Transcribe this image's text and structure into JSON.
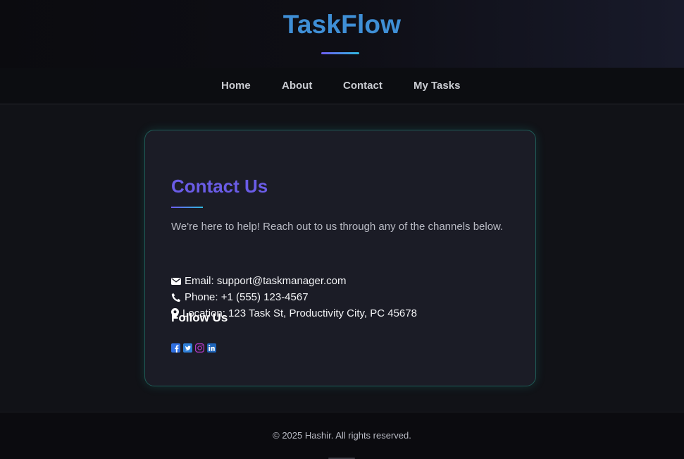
{
  "header": {
    "brand": "TaskFlow",
    "brand_color": "#3f8fd6"
  },
  "nav": {
    "items": [
      {
        "label": "Home"
      },
      {
        "label": "About"
      },
      {
        "label": "Contact"
      },
      {
        "label": "My Tasks"
      }
    ]
  },
  "contact": {
    "title": "Contact Us",
    "intro": "We're here to help! Reach out to us through any of the channels below.",
    "email": {
      "icon": "envelope-icon",
      "text": "Email: support@taskmanager.com"
    },
    "phone": {
      "icon": "phone-icon",
      "text": "Phone: +1 (555) 123-4567"
    },
    "location": {
      "icon": "map-pin-icon",
      "text": "Location: 123 Task St, Productivity City, PC 45678"
    },
    "follow_title": "Follow Us",
    "socials": [
      {
        "icon": "facebook-icon",
        "color": "#2f6fe0"
      },
      {
        "icon": "twitter-icon",
        "color": "#2f7fd8"
      },
      {
        "icon": "instagram-icon",
        "color": "#b23ac4"
      },
      {
        "icon": "linkedin-icon",
        "color": "#1e64b8"
      }
    ]
  },
  "footer": {
    "copyright": "© 2025 Hashir. All rights reserved."
  },
  "colors": {
    "accent": "#6a5ce6",
    "background": "#111217",
    "card": "#1b1c26"
  }
}
